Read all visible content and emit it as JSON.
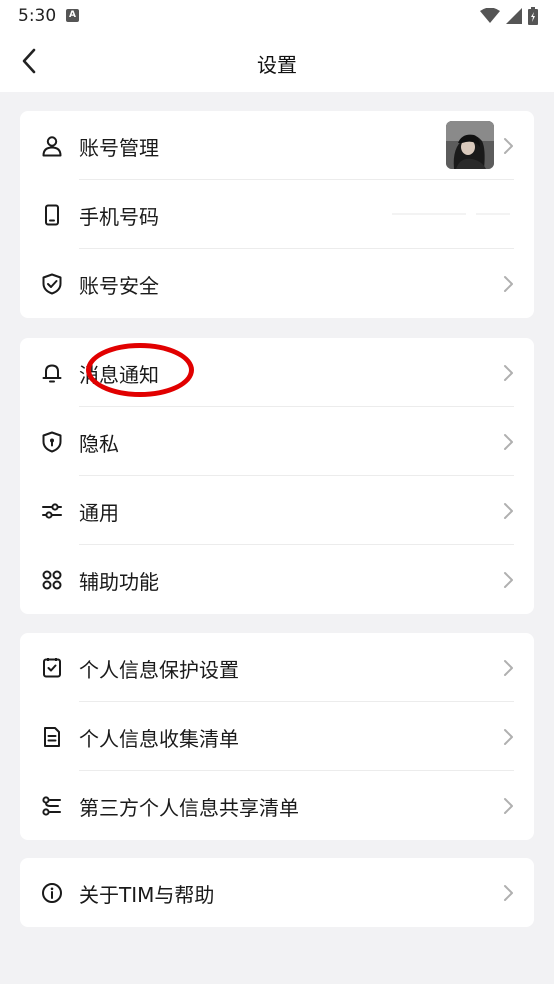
{
  "status": {
    "time": "5:30",
    "notif_glyph": "A",
    "icons": [
      "wifi-icon",
      "signal-icon",
      "battery-icon"
    ]
  },
  "nav": {
    "title": "设置",
    "back_icon": "back-arrow-icon"
  },
  "groups": [
    {
      "items": [
        {
          "label": "账号管理",
          "icon": "user-icon",
          "has_avatar": true
        },
        {
          "label": "手机号码",
          "icon": "phone-icon"
        },
        {
          "label": "账号安全",
          "icon": "shield-check-icon"
        }
      ]
    },
    {
      "items": [
        {
          "label": "消息通知",
          "icon": "bell-icon"
        },
        {
          "label": "隐私",
          "icon": "privacy-shield-icon"
        },
        {
          "label": "通用",
          "icon": "sliders-icon"
        },
        {
          "label": "辅助功能",
          "icon": "command-icon"
        }
      ]
    },
    {
      "items": [
        {
          "label": "个人信息保护设置",
          "icon": "checkbox-doc-icon"
        },
        {
          "label": "个人信息收集清单",
          "icon": "document-list-icon"
        },
        {
          "label": "第三方个人信息共享清单",
          "icon": "share-list-icon"
        }
      ]
    },
    {
      "items": [
        {
          "label": "关于TIM与帮助",
          "icon": "info-icon"
        }
      ]
    }
  ],
  "colors": {
    "background": "#f2f2f4",
    "card": "#ffffff",
    "annotation": "#e10000",
    "chevron": "#b0b0b0"
  }
}
